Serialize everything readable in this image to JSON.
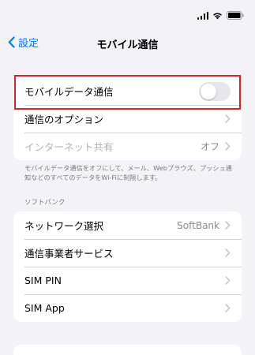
{
  "nav": {
    "back_label": "設定",
    "title": "モバイル通信"
  },
  "group1": {
    "rows": [
      {
        "label": "モバイルデータ通信",
        "toggle": false
      },
      {
        "label": "通信のオプション"
      },
      {
        "label": "インターネット共有",
        "value": "オフ",
        "disabled": true
      }
    ]
  },
  "footnote": "モバイルデータ通信をオフにして、メール、Webブラウズ、プッシュ通知などのすべてのデータをWi-Fiに制限します。",
  "carrier": {
    "header": "ソフトバンク",
    "rows": [
      {
        "label": "ネットワーク選択",
        "value": "SoftBank"
      },
      {
        "label": "通信事業者サービス"
      },
      {
        "label": "SIM PIN"
      },
      {
        "label": "SIM App"
      }
    ]
  },
  "colors": {
    "accent": "#007aff",
    "highlight": "#d9232b",
    "background": "#f2f2f7"
  },
  "icons": [
    "signal-icon",
    "wifi-icon",
    "battery-icon",
    "chevron-left-icon",
    "chevron-right-icon"
  ]
}
